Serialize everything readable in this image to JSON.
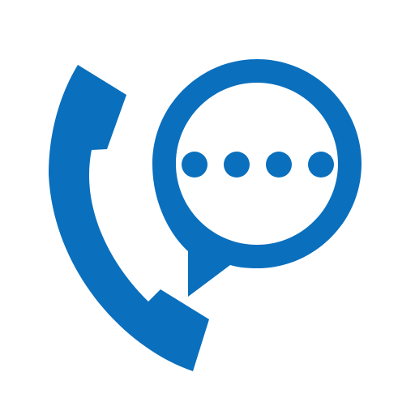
{
  "icon": {
    "name": "phone-chat-icon",
    "parts": [
      "phone-handset-icon",
      "speech-bubble-icon",
      "typing-dots-icon"
    ],
    "colors": {
      "primary": "#0a6fbd",
      "background": "#ffffff"
    },
    "dot_count": 4
  }
}
